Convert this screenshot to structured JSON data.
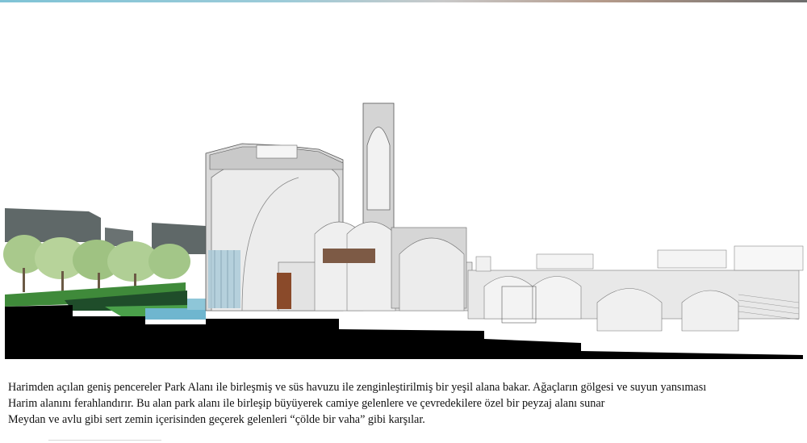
{
  "caption": {
    "lines": [
      "Harimden açılan geniş pencereler Park Alanı ile birleşmiş ve süs havuzu ile zenginleştirilmiş bir yeşil alana bakar. Ağaçların gölgesi ve suyun yansıması",
      "Harim alanını ferahlandırır. Bu alan park alanı ile birleşip büyüyerek camiye gelenlere ve çevredekilere özel bir peyzaj alanı sunar",
      "Meydan ve avlu gibi sert zemin içerisinden geçerek gelenleri “çölde bir vaha” gibi karşılar."
    ]
  },
  "drawing": {
    "colors": {
      "ground": "#000000",
      "water": "#6fb6cf",
      "grass": "#3f8a3a",
      "building_mass": "#5f6868",
      "wall": "#d9d9d9",
      "vault": "#eeeeee",
      "wood": "#8a4a2a",
      "glass": "#a8c9d8"
    }
  }
}
